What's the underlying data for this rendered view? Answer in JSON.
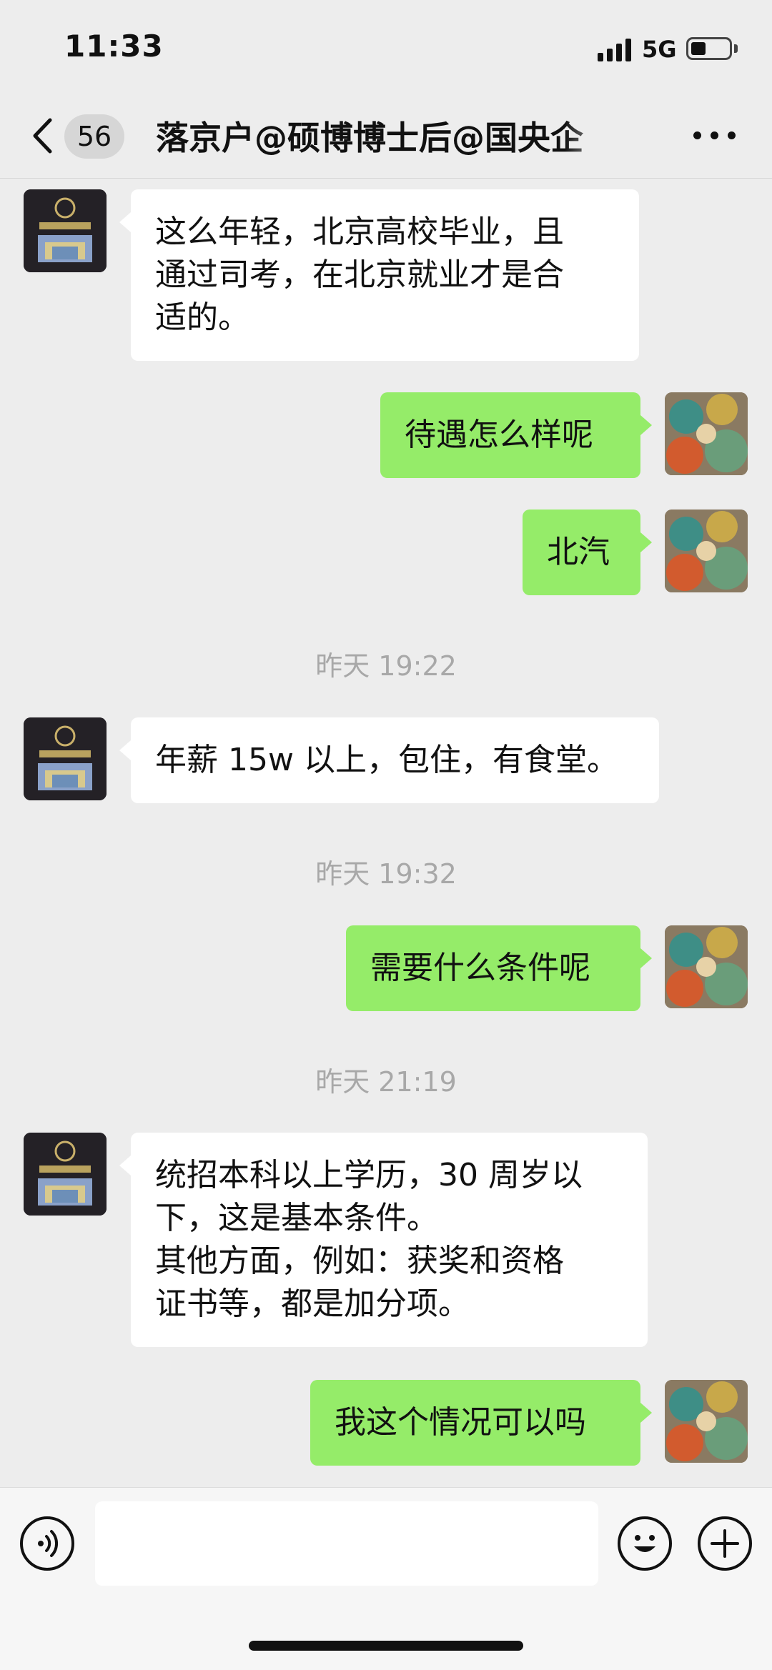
{
  "status_bar": {
    "time": "11:33",
    "network": "5G"
  },
  "nav": {
    "unread_count": "56",
    "title": "落京户@硕博博士后@国央企"
  },
  "messages": [
    {
      "side": "left",
      "lines": [
        "这么年轻，北京高校毕业，且",
        "通过司考，在北京就业才是合",
        "适的。"
      ]
    },
    {
      "side": "right",
      "lines": [
        "待遇怎么样呢"
      ]
    },
    {
      "side": "right",
      "lines": [
        "北汽"
      ]
    },
    {
      "time": "昨天 19:22"
    },
    {
      "side": "left",
      "lines": [
        "年薪 15w 以上，包住，有食堂。"
      ]
    },
    {
      "time": "昨天 19:32"
    },
    {
      "side": "right",
      "lines": [
        "需要什么条件呢"
      ]
    },
    {
      "time": "昨天 21:19"
    },
    {
      "side": "left",
      "lines": [
        "统招本科以上学历，30 周岁以",
        "下，这是基本条件。",
        "其他方面，例如：获奖和资格",
        "证书等，都是加分项。"
      ]
    },
    {
      "side": "right",
      "lines": [
        "我这个情况可以吗"
      ]
    }
  ],
  "colors": {
    "own_bubble": "#95ec69",
    "other_bubble": "#ffffff",
    "background": "#ededed"
  },
  "icons": [
    "back-chevron-icon",
    "more-dots-icon",
    "voice-icon",
    "emoji-icon",
    "plus-icon"
  ]
}
